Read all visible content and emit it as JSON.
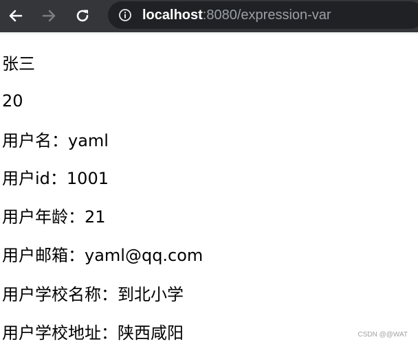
{
  "browser": {
    "url_host": "localhost",
    "url_port": ":8080",
    "url_path": "/expression-var"
  },
  "content": {
    "lines": [
      "张三",
      "20",
      "用户名：yaml",
      "用户id：1001",
      "用户年龄：21",
      "用户邮箱：yaml@qq.com",
      "用户学校名称：到北小学",
      "用户学校地址：陕西咸阳"
    ]
  },
  "watermark": "CSDN @@WAT"
}
